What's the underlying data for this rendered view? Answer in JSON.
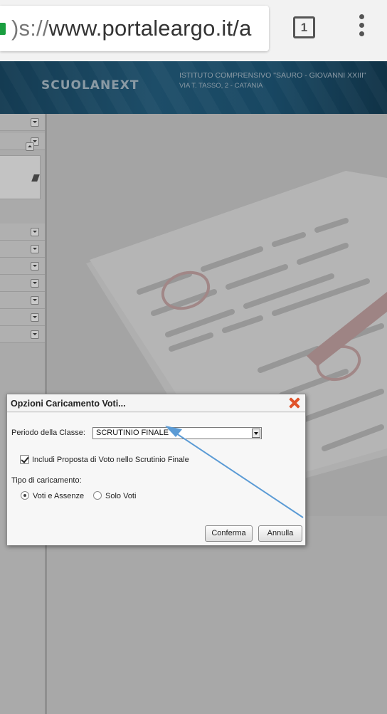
{
  "browser": {
    "url_scheme": ")s://",
    "url_rest": "www.portaleargo.it/a",
    "tab_count": "1"
  },
  "header": {
    "brand": "SCUOLANEXT",
    "school_name": "ISTITUTO COMPRENSIVO \"SAURO - GIOVANNI XXIII\"",
    "school_address": "VIA T. TASSO, 2 - CATANIA"
  },
  "dialog": {
    "title": "Opzioni Caricamento Voti...",
    "period_label": "Periodo della Classe:",
    "period_value": "SCRUTINIO FINALE",
    "checkbox_label": "Includi Proposta di Voto nello Scrutinio Finale",
    "checkbox_checked": true,
    "load_type_label": "Tipo di caricamento:",
    "radio_options": [
      {
        "label": "Voti e Assenze",
        "selected": true
      },
      {
        "label": "Solo Voti",
        "selected": false
      }
    ],
    "confirm_label": "Conferma",
    "cancel_label": "Annulla"
  },
  "colors": {
    "header_bg": "#1d4d68",
    "close_icon": "#e0532a",
    "annotation_arrow": "#5b9bd5",
    "lock_icon": "#1a9e3f"
  }
}
